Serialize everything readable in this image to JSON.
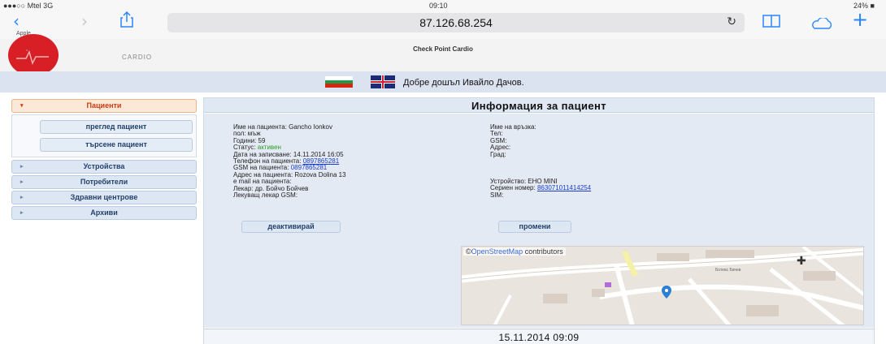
{
  "status_bar": {
    "carrier": "●●●○○ Mtel  3G",
    "time": "09:10",
    "battery": "24% ■"
  },
  "browser": {
    "url": "87.126.68.254",
    "back_label": "Apple"
  },
  "header": {
    "site_title": "Check Point Cardio",
    "logo_text": "CARDIO",
    "welcome": "Добре дошъл Ивайло Дачов."
  },
  "sidebar": {
    "patients": "Пациенти",
    "sub": [
      "преглед пациент",
      "търсене пациент"
    ],
    "items": [
      "Устройства",
      "Потребители",
      "Здравни центрове",
      "Архиви"
    ]
  },
  "main": {
    "title": "Информация за пациент",
    "left_info": {
      "name": "Име на пациента: Gancho Ionkov",
      "gender": "пол: мъж",
      "age": "Години: 59",
      "status_label": "Статус:",
      "status_value": "активен",
      "date_recorded": "Дата на записване: 14.11.2014 16:05",
      "phone_label": "Телефон на пациента:",
      "phone_value": "0897865281",
      "gsm_label": "GSM на пациента:",
      "gsm_value": "0897865281",
      "address": "Адрес на пациента: Rozova Dolina 13",
      "email": "e mail на пациента:",
      "doctor": "Лекар: др. Бойчо Бойчев",
      "doctor_gsm": "Лекуващ лекар GSM:"
    },
    "right_info": {
      "relative": "Име на връзка:",
      "tel": "Тел:",
      "gsm": "GSM:",
      "address": "Адрес:",
      "city": "Град:",
      "device": "Устройство: EHO MINI",
      "serial_label": "Сериен номер:",
      "serial_value": "863071011414254",
      "sim": "SIM:"
    },
    "buttons": {
      "deactivate": "деактивирай",
      "change": "промени"
    },
    "map": {
      "attribution_prefix": "©",
      "attribution_link": "OpenStreetMap",
      "attribution_suffix": " contributors",
      "street_label": "Ботевс Бачев"
    },
    "date": "15.11.2014 09:09"
  },
  "colors": {
    "accent_blue": "#2a86ff",
    "logo_red": "#d91f26",
    "active_menu": "#cc3a12",
    "link": "#1a3dcc"
  }
}
